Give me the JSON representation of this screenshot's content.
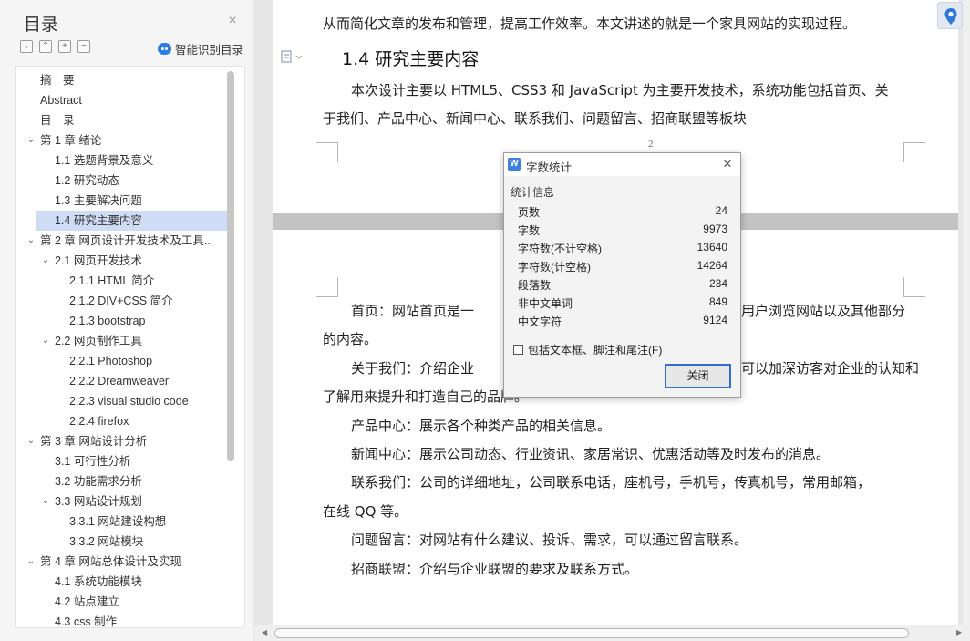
{
  "toc": {
    "title": "目录",
    "close_glyph": "×",
    "tools": [
      "⌄",
      "⌃",
      "+",
      "−"
    ],
    "smart_label": "智能识别目录",
    "items": [
      {
        "label": "摘　要",
        "level": 0,
        "caret": ""
      },
      {
        "label": "Abstract",
        "level": 0,
        "caret": ""
      },
      {
        "label": "目　录",
        "level": 0,
        "caret": ""
      },
      {
        "label": "第 1 章  绪论",
        "level": 0,
        "caret": "⌄"
      },
      {
        "label": "1.1 选题背景及意义",
        "level": 1,
        "caret": ""
      },
      {
        "label": "1.2 研究动态",
        "level": 1,
        "caret": ""
      },
      {
        "label": "1.3 主要解决问题",
        "level": 1,
        "caret": ""
      },
      {
        "label": "1.4 研究主要内容",
        "level": 1,
        "caret": "",
        "active": true
      },
      {
        "label": "第 2 章  网页设计开发技术及工具...",
        "level": 0,
        "caret": "⌄"
      },
      {
        "label": "2.1  网页开发技术",
        "level": 1,
        "caret": "⌄"
      },
      {
        "label": "2.1.1 HTML 简介",
        "level": 2,
        "caret": ""
      },
      {
        "label": "2.1.2 DIV+CSS 简介",
        "level": 2,
        "caret": ""
      },
      {
        "label": "2.1.3 bootstrap",
        "level": 2,
        "caret": ""
      },
      {
        "label": "2.2  网页制作工具",
        "level": 1,
        "caret": "⌄"
      },
      {
        "label": "2.2.1 Photoshop",
        "level": 2,
        "caret": ""
      },
      {
        "label": "2.2.2 Dreamweaver",
        "level": 2,
        "caret": ""
      },
      {
        "label": "2.2.3 visual studio code",
        "level": 2,
        "caret": ""
      },
      {
        "label": "2.2.4 firefox",
        "level": 2,
        "caret": ""
      },
      {
        "label": "第 3 章  网站设计分析",
        "level": 0,
        "caret": "⌄"
      },
      {
        "label": "3.1  可行性分析",
        "level": 1,
        "caret": ""
      },
      {
        "label": "3.2  功能需求分析",
        "level": 1,
        "caret": ""
      },
      {
        "label": "3.3  网站设计规划",
        "level": 1,
        "caret": "⌄"
      },
      {
        "label": "3.3.1  网站建设构想",
        "level": 2,
        "caret": ""
      },
      {
        "label": "3.3.2  网站模块",
        "level": 2,
        "caret": ""
      },
      {
        "label": "第 4 章  网站总体设计及实现",
        "level": 0,
        "caret": "⌄"
      },
      {
        "label": "4.1  系统功能模块",
        "level": 1,
        "caret": ""
      },
      {
        "label": "4.2  站点建立",
        "level": 1,
        "caret": ""
      },
      {
        "label": "4.3 css 制作",
        "level": 1,
        "caret": ""
      }
    ]
  },
  "document": {
    "top_line": "从而简化文章的发布和管理，提高工作效率。本文讲述的就是一个家具网站的实现过程。",
    "heading": "1.4 研究主要内容",
    "intro_1": "本次设计主要以 HTML5、CSS3 和 JavaScript 为主要开发技术，系统功能包括首页、关",
    "intro_2": "于我们、产品中心、新闻中心、联系我们、问题留言、招商联盟等板块",
    "page_number": "2",
    "lines": [
      {
        "text": "首页：网站首页是一",
        "indent": true
      },
      {
        "text": "的内容。",
        "indent": false
      },
      {
        "text": "关于我们：介绍企业",
        "indent": true
      },
      {
        "text": "了解用来提升和打造自己的品牌。",
        "indent": false
      },
      {
        "text": "产品中心：展示各个种类产品的相关信息。",
        "indent": true
      },
      {
        "text": "新闻中心：展示公司动态、行业资讯、家居常识、优惠活动等及时发布的消息。",
        "indent": true
      },
      {
        "text": "联系我们：公司的详细地址，公司联系电话，座机号，手机号，传真机号，常用邮箱，",
        "indent": true
      },
      {
        "text": "在线 QQ 等。",
        "indent": false
      },
      {
        "text": "问题留言：对网站有什么建议、投诉、需求，可以通过留言联系。",
        "indent": true
      },
      {
        "text": "招商联盟：介绍与企业联盟的要求及联系方式。",
        "indent": true
      }
    ],
    "line_1_tail": "用户浏览网站以及其他部分",
    "line_3_tail": "可以加深访客对企业的认知和"
  },
  "word_count": {
    "title": "字数统计",
    "close_glyph": "×",
    "group_label": "统计信息",
    "stats": [
      {
        "label": "页数",
        "value": "24"
      },
      {
        "label": "字数",
        "value": "9973"
      },
      {
        "label": "字符数(不计空格)",
        "value": "13640"
      },
      {
        "label": "字符数(计空格)",
        "value": "14264"
      },
      {
        "label": "段落数",
        "value": "234"
      },
      {
        "label": "非中文单词",
        "value": "849"
      },
      {
        "label": "中文字符",
        "value": "9124"
      }
    ],
    "checkbox_label": "包括文本框、脚注和尾注(F)",
    "close_button": "关闭"
  }
}
